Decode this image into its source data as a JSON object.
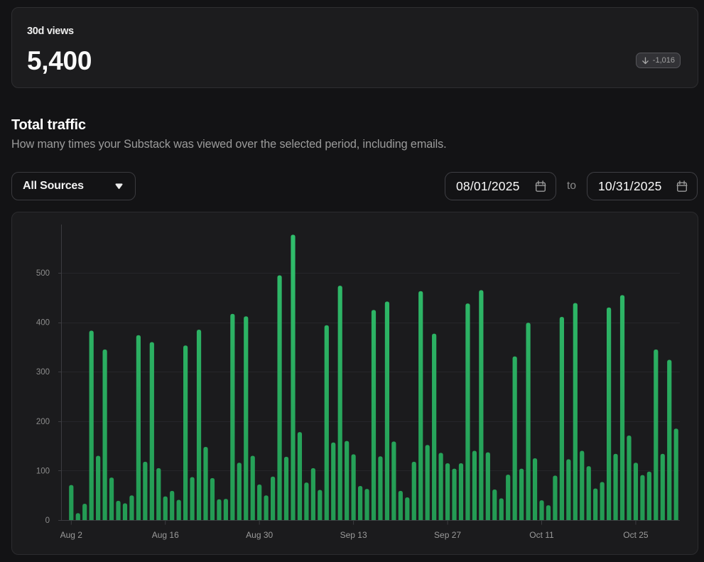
{
  "stat_card": {
    "label": "30d views",
    "value": "5,400",
    "change": "-1,016",
    "change_direction": "down"
  },
  "section": {
    "title": "Total traffic",
    "subtitle": "How many times your Substack was viewed over the selected period, including emails."
  },
  "controls": {
    "source_filter": {
      "value": "All Sources"
    },
    "date_range": {
      "start": "08/01/2025",
      "separator": "to",
      "end": "10/31/2025"
    }
  },
  "colors": {
    "background": "#131315",
    "card": "#1c1c1e",
    "border": "#2e2e31",
    "bar_green_top": "#31c06d",
    "bar_green_bottom": "#239a53",
    "gridline": "#26262a",
    "axis": "#3c3c40",
    "axis_label": "#8c8c8c",
    "x_label": "#9a9a9a"
  },
  "chart_data": {
    "type": "bar",
    "title": "Total traffic",
    "xlabel": "",
    "ylabel": "",
    "ylim": [
      0,
      600
    ],
    "y_ticks": [
      0,
      100,
      200,
      300,
      400,
      500
    ],
    "x_tick_labels": [
      "Aug 2",
      "Aug 16",
      "Aug 30",
      "Sep 13",
      "Sep 27",
      "Oct 11",
      "Oct 25"
    ],
    "x_tick_indices": [
      0,
      14,
      28,
      42,
      56,
      70,
      84
    ],
    "start_date": "Aug 2",
    "end_date": "Oct 31",
    "values": [
      71,
      14,
      33,
      383,
      130,
      345,
      86,
      39,
      34,
      50,
      374,
      118,
      360,
      105,
      48,
      59,
      41,
      353,
      87,
      385,
      148,
      85,
      42,
      43,
      417,
      116,
      412,
      130,
      72,
      50,
      88,
      495,
      128,
      577,
      178,
      76,
      105,
      61,
      394,
      157,
      474,
      160,
      133,
      69,
      63,
      425,
      129,
      442,
      159,
      59,
      46,
      118,
      463,
      152,
      377,
      136,
      115,
      104,
      115,
      438,
      140,
      465,
      137,
      62,
      44,
      92,
      331,
      104,
      399,
      125,
      40,
      30,
      90,
      411,
      123,
      439,
      140,
      109,
      64,
      77,
      430,
      134,
      455,
      171,
      116,
      91,
      98,
      345,
      134,
      324,
      185
    ]
  }
}
